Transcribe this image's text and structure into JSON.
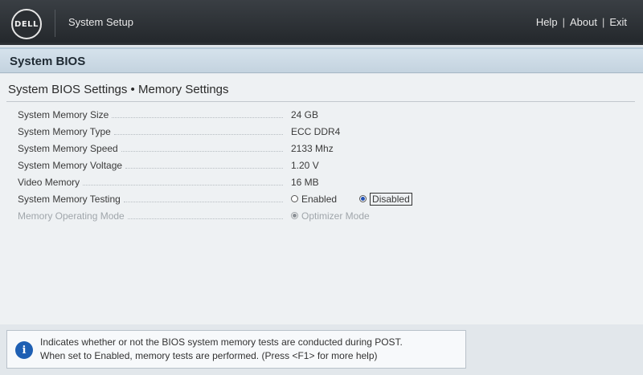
{
  "header": {
    "logo_text": "DELL",
    "app_title": "System Setup",
    "links": [
      "Help",
      "About",
      "Exit"
    ],
    "separator": "|"
  },
  "section": {
    "title": "System BIOS"
  },
  "page": {
    "title": "System BIOS Settings • Memory Settings",
    "settings": [
      {
        "label": "System Memory Size",
        "value": "24 GB"
      },
      {
        "label": "System Memory Type",
        "value": "ECC DDR4"
      },
      {
        "label": "System Memory Speed",
        "value": "2133 Mhz"
      },
      {
        "label": "System Memory Voltage",
        "value": "1.20 V"
      },
      {
        "label": "Video Memory",
        "value": "16 MB"
      },
      {
        "label": "System Memory Testing",
        "options": [
          "Enabled",
          "Disabled"
        ],
        "selected": "Disabled"
      },
      {
        "label": "Memory Operating Mode",
        "options": [
          "Optimizer Mode"
        ],
        "selected": "Optimizer Mode",
        "disabled": true
      }
    ]
  },
  "help": {
    "icon": "info-icon",
    "line1": "Indicates whether or not the BIOS system memory tests are conducted during POST.",
    "line2": "When set to Enabled, memory tests are performed. (Press <F1> for more help)"
  }
}
